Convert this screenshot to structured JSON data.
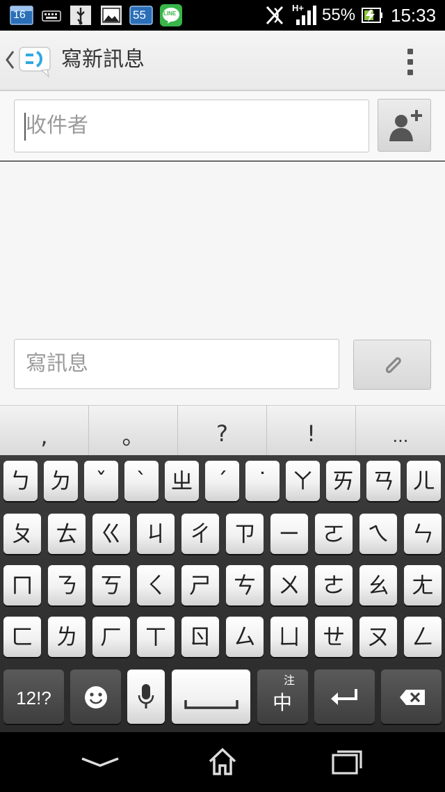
{
  "status_bar": {
    "calendar_day": "16",
    "notification_count": "55",
    "line_badge": "LINE",
    "network_type": "H+",
    "battery_percent": "55%",
    "time": "15:33",
    "icons": [
      "calendar-icon",
      "keyboard-icon",
      "usb-icon",
      "picture-icon",
      "notification-count-icon",
      "line-app-icon",
      "nfc-off-icon",
      "signal-icon",
      "battery-icon"
    ]
  },
  "action_bar": {
    "title": "寫新訊息"
  },
  "recipient": {
    "placeholder": "收件者"
  },
  "compose": {
    "placeholder": "寫訊息"
  },
  "keyboard": {
    "punctuation": [
      ",",
      "。",
      "?",
      "!",
      "..."
    ],
    "rows": [
      [
        "ㄅ",
        "ㄉ",
        "ˇ",
        "ˋ",
        "ㄓ",
        "ˊ",
        "˙",
        "ㄚ",
        "ㄞ",
        "ㄢ",
        "ㄦ"
      ],
      [
        "ㄆ",
        "ㄊ",
        "ㄍ",
        "ㄐ",
        "ㄔ",
        "ㄗ",
        "ㄧ",
        "ㄛ",
        "ㄟ",
        "ㄣ"
      ],
      [
        "ㄇ",
        "ㄋ",
        "ㄎ",
        "ㄑ",
        "ㄕ",
        "ㄘ",
        "ㄨ",
        "ㄜ",
        "ㄠ",
        "ㄤ"
      ],
      [
        "ㄈ",
        "ㄌ",
        "ㄏ",
        "ㄒ",
        "ㄖ",
        "ㄙ",
        "ㄩ",
        "ㄝ",
        "ㄡ",
        "ㄥ"
      ]
    ],
    "symbols_key": "12!?",
    "lang_key_top": "注",
    "lang_key_main": "中"
  }
}
